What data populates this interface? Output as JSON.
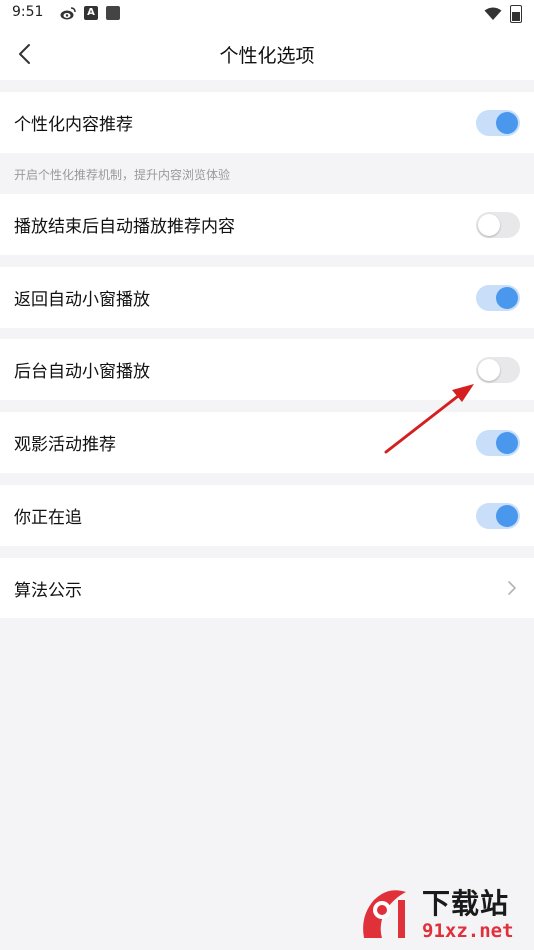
{
  "status_bar": {
    "time": "9:51",
    "icons": [
      "weibo-icon",
      "a-icon",
      "square-icon"
    ],
    "right_icons": [
      "wifi-icon",
      "battery-icon"
    ],
    "a_icon_letter": "A"
  },
  "header": {
    "title": "个性化选项",
    "back_icon": "chevron-left-icon"
  },
  "settings": [
    {
      "label": "个性化内容推荐",
      "toggle": "on"
    },
    {
      "label": "播放结束后自动播放推荐内容",
      "toggle": "off"
    },
    {
      "label": "返回自动小窗播放",
      "toggle": "on"
    },
    {
      "label": "后台自动小窗播放",
      "toggle": "off"
    },
    {
      "label": "观影活动推荐",
      "toggle": "on"
    },
    {
      "label": "你正在追",
      "toggle": "on"
    },
    {
      "label": "算法公示",
      "toggle": null,
      "trailing_icon": "chevron-right-icon"
    }
  ],
  "hint": "开启个性化推荐机制，提升内容浏览体验",
  "colors": {
    "toggle_on_track": "#c9def8",
    "toggle_on_knob": "#4a98ee",
    "toggle_off_track": "#e8e8ea",
    "annotation_arrow": "#d42020",
    "background": "#f4f4f6"
  },
  "watermark": {
    "chinese": "下载站",
    "domain": "91xz.net",
    "logo_icon": "91-logo-icon"
  }
}
